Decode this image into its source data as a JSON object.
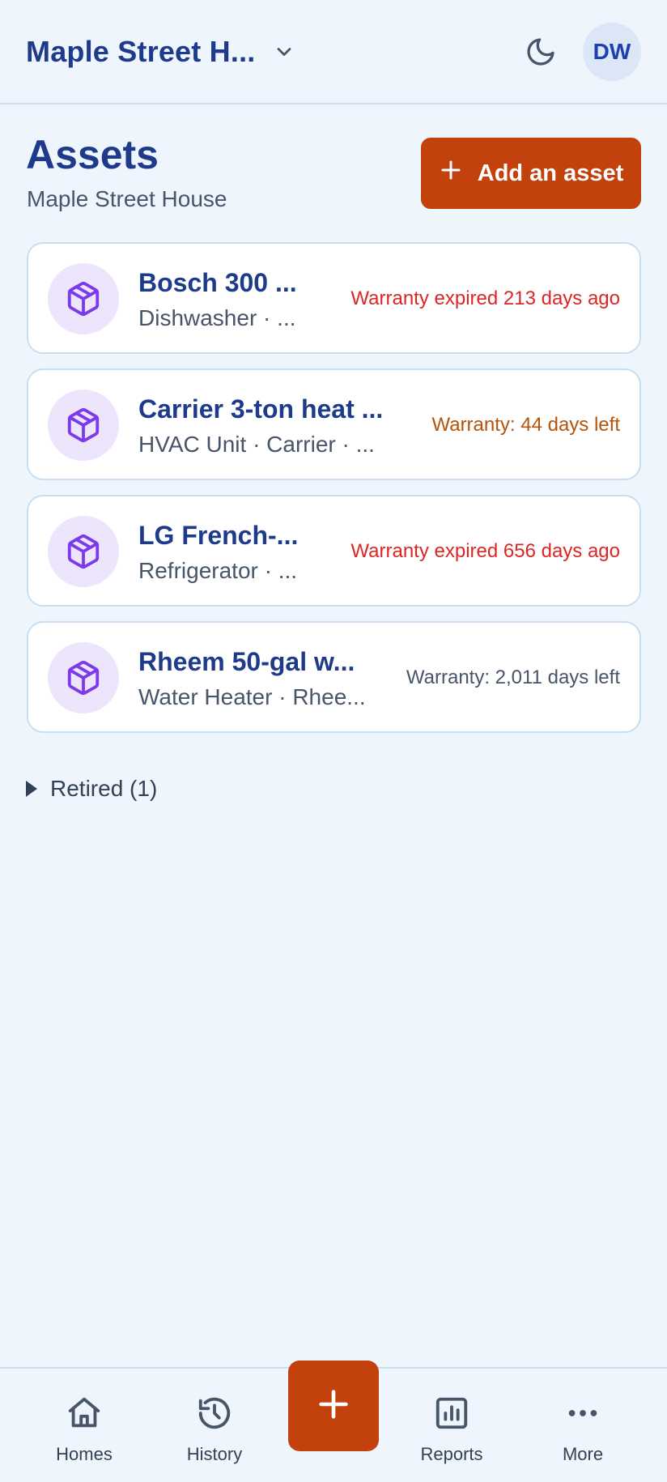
{
  "header": {
    "home_name": "Maple Street H...",
    "avatar_initials": "DW"
  },
  "page": {
    "title": "Assets",
    "subtitle": "Maple Street House",
    "add_button_label": "Add an asset"
  },
  "assets": [
    {
      "name": "Bosch 300 ...",
      "meta": "Dishwasher · ...",
      "warranty": "Warranty expired 213 days ago",
      "warranty_color": "#dc2626",
      "icon": "package-icon"
    },
    {
      "name": "Carrier 3-ton heat ...",
      "meta": "HVAC Unit · Carrier · ...",
      "warranty": "Warranty: 44 days left",
      "warranty_color": "#b45309",
      "icon": "package-icon"
    },
    {
      "name": "LG French-...",
      "meta": "Refrigerator · ...",
      "warranty": "Warranty expired 656 days ago",
      "warranty_color": "#dc2626",
      "icon": "package-icon"
    },
    {
      "name": "Rheem 50-gal w...",
      "meta": "Water Heater · Rhee...",
      "warranty": "Warranty: 2,011 days left",
      "warranty_color": "#475569",
      "icon": "package-icon"
    }
  ],
  "retired": {
    "label": "Retired (1)"
  },
  "nav": {
    "items": [
      {
        "label": "Homes",
        "icon": "home-icon"
      },
      {
        "label": "History",
        "icon": "history-icon"
      },
      {
        "label": "Reports",
        "icon": "reports-icon"
      },
      {
        "label": "More",
        "icon": "more-icon"
      }
    ],
    "fab_icon": "plus-icon"
  },
  "colors": {
    "accent": "#c2410c",
    "primary_text": "#1e3a8a",
    "background": "#eef5fd",
    "icon_purple": "#7c3aed"
  }
}
